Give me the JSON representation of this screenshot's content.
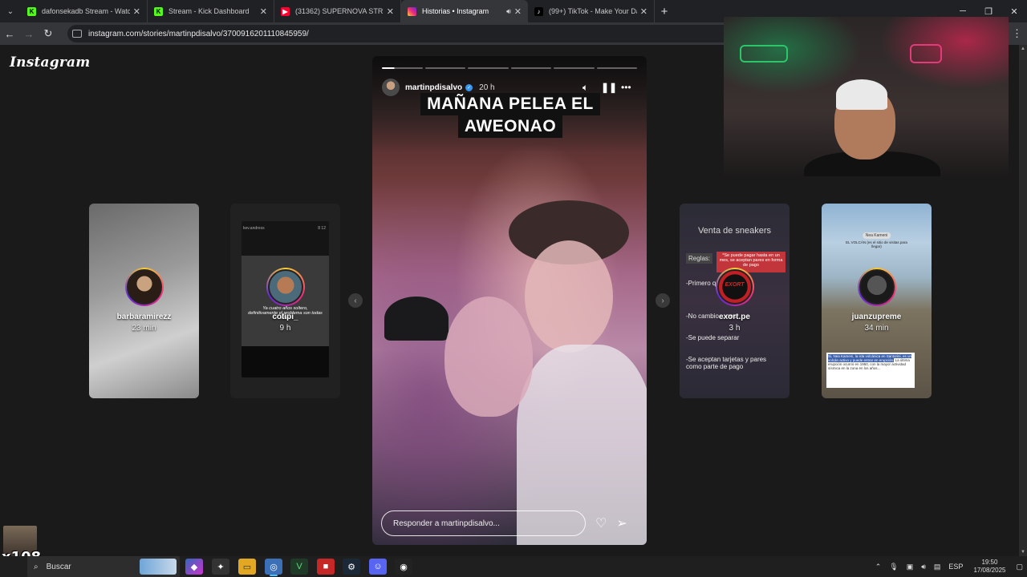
{
  "browser": {
    "tabs": [
      {
        "label": "dafonsekadb Stream - Watch Li",
        "favicon": "kick-icon",
        "active": false
      },
      {
        "label": "Stream - Kick Dashboard",
        "favicon": "kick-icon",
        "active": false
      },
      {
        "label": "(31362) SUPERNOVA STRIKERS",
        "favicon": "youtube-icon",
        "active": false
      },
      {
        "label": "Historias • Instagram",
        "favicon": "instagram-icon",
        "active": true,
        "audio": true
      },
      {
        "label": "(99+) TikTok - Make Your Day",
        "favicon": "tiktok-icon",
        "active": false
      }
    ],
    "url": "instagram.com/stories/martinpdisalvo/3700916201110845959/"
  },
  "instagram": {
    "logo": "Instagram",
    "side_stories": [
      {
        "name": "barbaramirezz",
        "time": "23 min"
      },
      {
        "name": "cotipi_",
        "time": "9 h",
        "inner_user": "kev.andress",
        "inner_time": "8 12",
        "quote": "Ya cuatro años soltero, definitivamente el problema son todas ellas."
      },
      {
        "name": "exort.pe",
        "time": "3 h",
        "title": "Venta de sneakers",
        "reglas": "Reglas:",
        "red_note": "*Se puede pagar hasta en un mes, se aceptan pares en forma de pago",
        "rules": [
          "-Primero q... se lo lleva",
          "-No cambio... nes",
          "-Se puede separar",
          "-Se aceptan tarjetas y pares como parte de pago"
        ],
        "logo_text": "EXORT"
      },
      {
        "name": "juanzupreme",
        "time": "34 min",
        "tag": "Nea Kameni",
        "top_caption": "EL VOLCÁN (es el sitio de visitas para llegar)",
        "highlight": "Si, Nea Kameni, la isla volcánica en Santorini, es un volcán activo y puede entrar en erupción.",
        "body": "La última erupción ocurrió en 1950, con la mayor actividad sísmica en la zona en los años..."
      }
    ],
    "main_story": {
      "username": "martinpdisalvo",
      "time": "20 h",
      "caption": [
        "MAÑANA PELEA EL",
        "AWEONAO"
      ],
      "reply_placeholder": "Responder a martinpdisalvo...",
      "progress": {
        "segments": 6,
        "completed": 0,
        "current_fraction": 0.3
      }
    }
  },
  "overlay": {
    "meme_text": "x108"
  },
  "taskbar": {
    "search_label": "Buscar",
    "language": "ESP",
    "time": "19:50",
    "date": "17/08/2025"
  },
  "colors": {
    "verified_blue": "#3797f0",
    "kick_green": "#53fc18",
    "youtube_red": "#ff0033"
  }
}
